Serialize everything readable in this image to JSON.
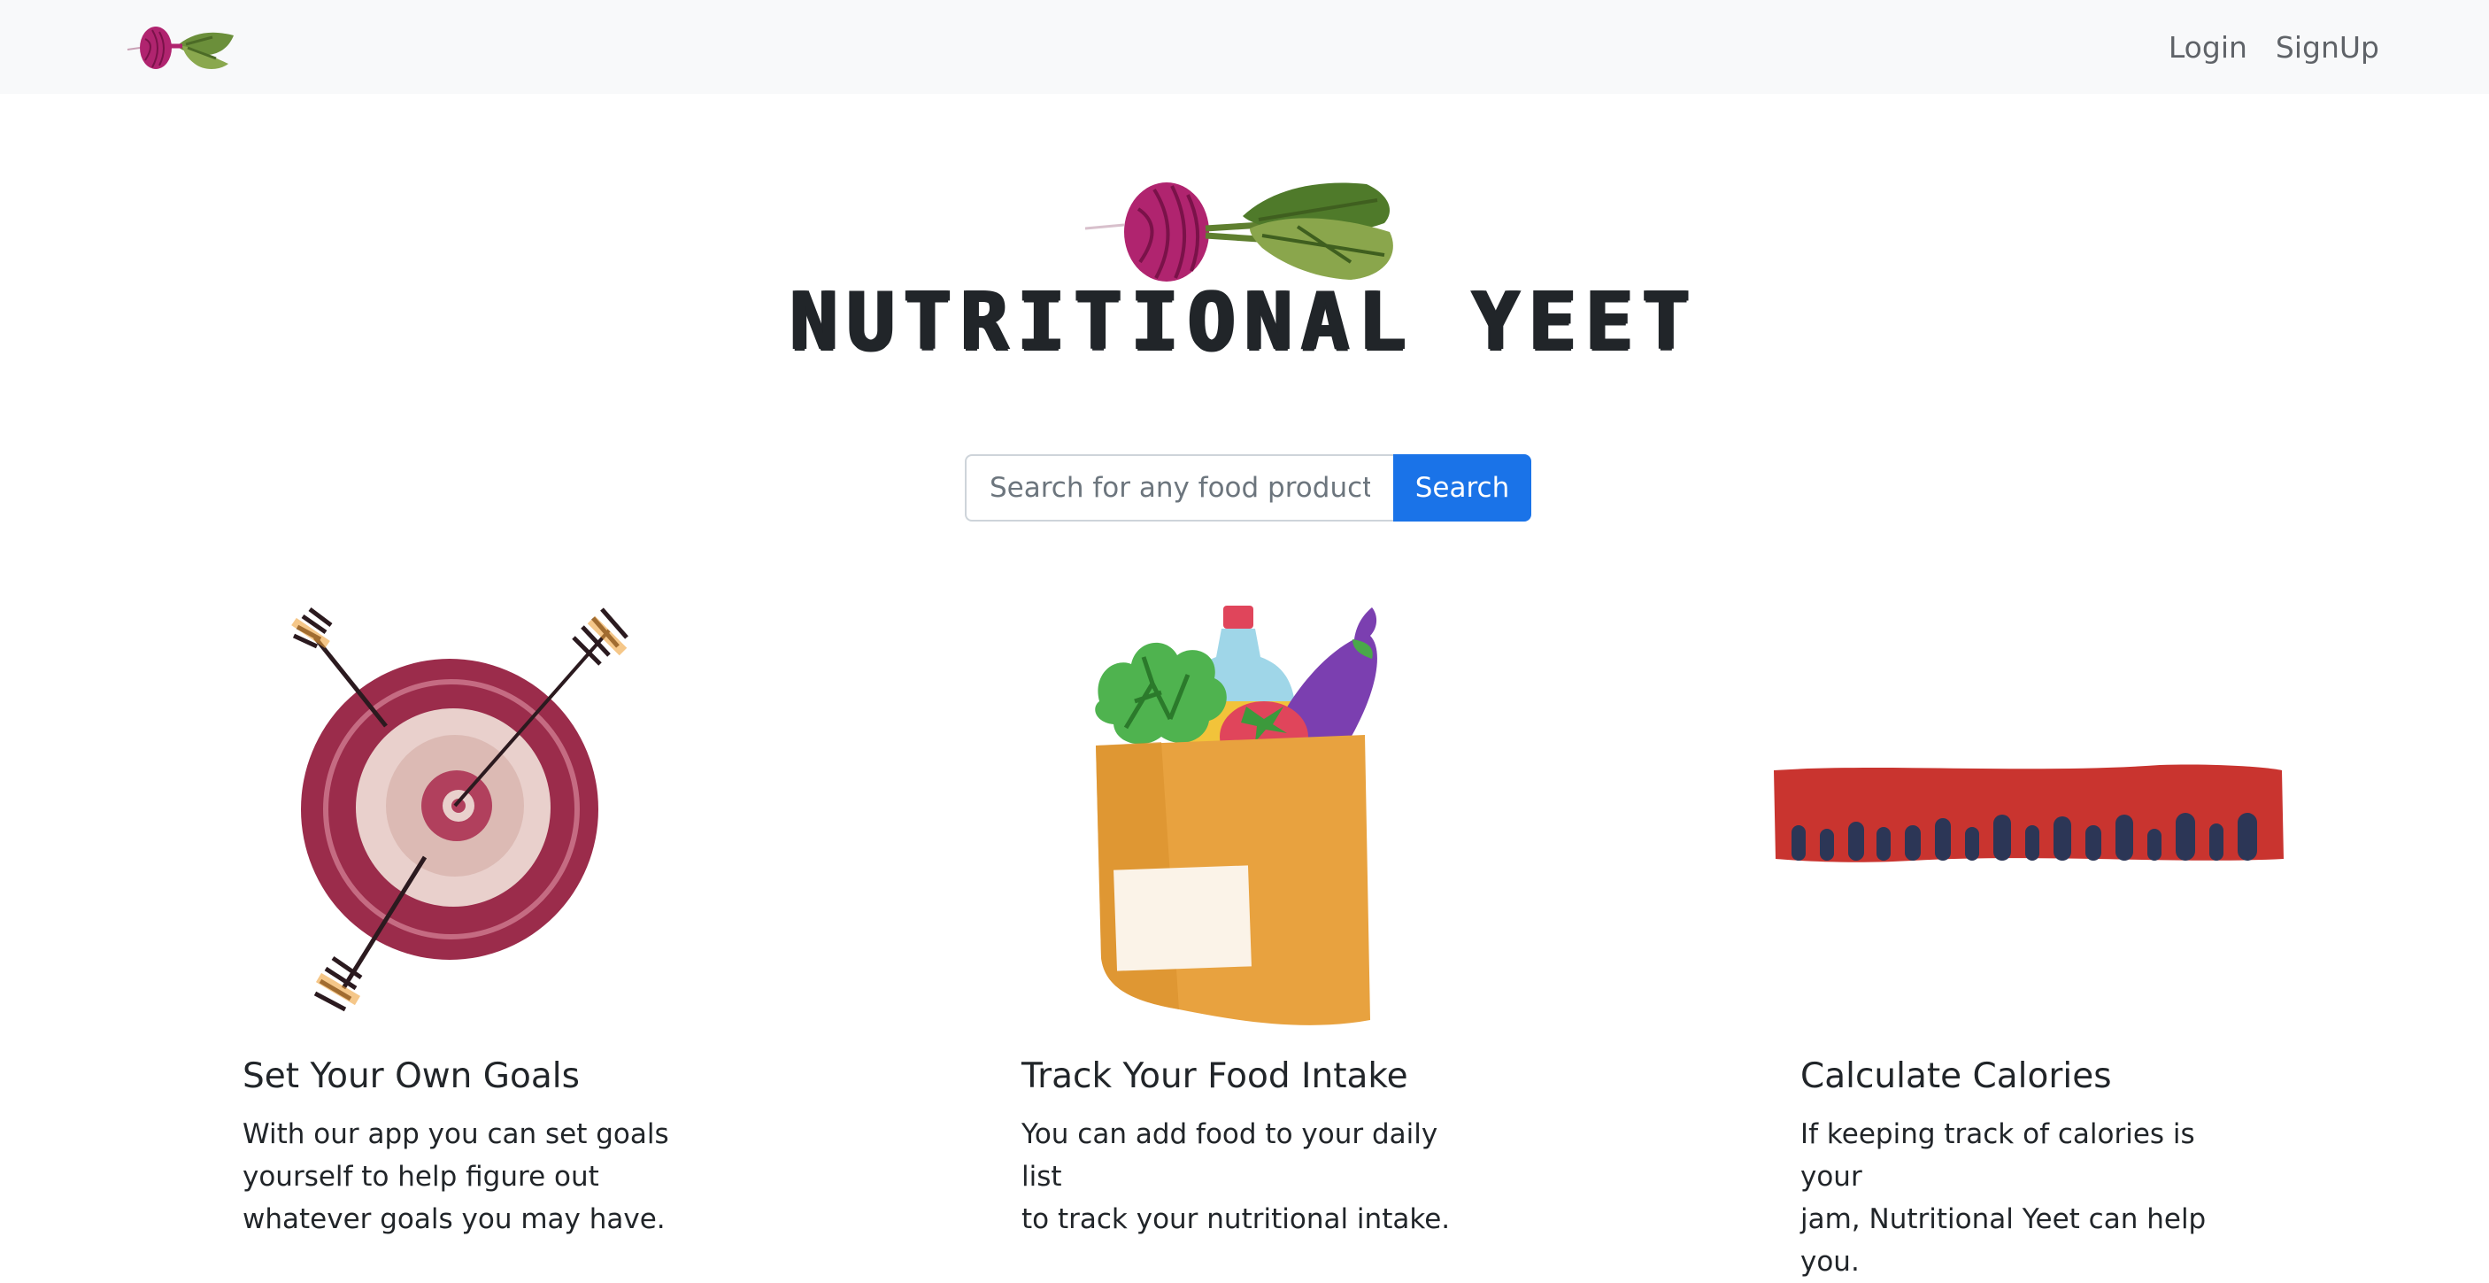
{
  "nav": {
    "logo_icon": "beet-icon",
    "links": [
      "Login",
      "SignUp"
    ]
  },
  "hero": {
    "logo_icon": "beet-icon",
    "title": "NUTRITIONAL YEET"
  },
  "search": {
    "placeholder": "Search for any food product",
    "value": "",
    "button_label": "Search"
  },
  "features": [
    {
      "icon": "target-arrows-icon",
      "title": "Set Your Own Goals",
      "lines": [
        "With our app you can set goals",
        "yourself to help figure out",
        "whatever goals you may have."
      ]
    },
    {
      "icon": "grocery-bag-icon",
      "title": "Track Your Food Intake",
      "lines": [
        "You can add food to your daily list",
        "to track your nutritional intake."
      ]
    },
    {
      "icon": "ruler-icon",
      "title": "Calculate Calories",
      "lines": [
        "If keeping track of calories is your",
        "jam, Nutritional Yeet can help you."
      ]
    }
  ],
  "colors": {
    "navbar_bg": "#f8f9fa",
    "primary_button": "#1a73e8",
    "beet": "#b0246f",
    "leaf": "#6b8f3a"
  }
}
